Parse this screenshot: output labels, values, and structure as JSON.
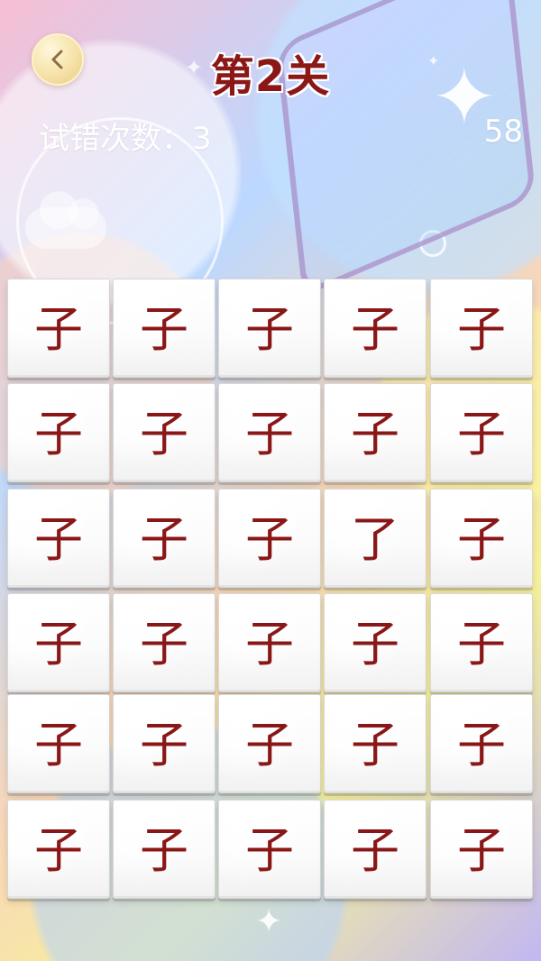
{
  "header": {
    "title": "第2关",
    "error_label": "试错次数：3",
    "timer": "58"
  },
  "board": {
    "rows": [
      [
        "子",
        "子",
        "子",
        "子",
        "子"
      ],
      [
        "子",
        "子",
        "子",
        "子",
        "子"
      ],
      [
        "子",
        "子",
        "子",
        "了",
        "子"
      ],
      [
        "子",
        "子",
        "子",
        "子",
        "子"
      ],
      [
        "子",
        "子",
        "子",
        "子",
        "子"
      ],
      [
        "子",
        "子",
        "子",
        "子",
        "子"
      ]
    ]
  },
  "icons": {
    "back": "chevron-left-icon",
    "sparkle": "sparkle-icon"
  },
  "colors": {
    "title": "#8b1717",
    "tile_text": "#8a1717",
    "tile_bg": "#ffffff",
    "back_button": "#f6e2a9"
  }
}
